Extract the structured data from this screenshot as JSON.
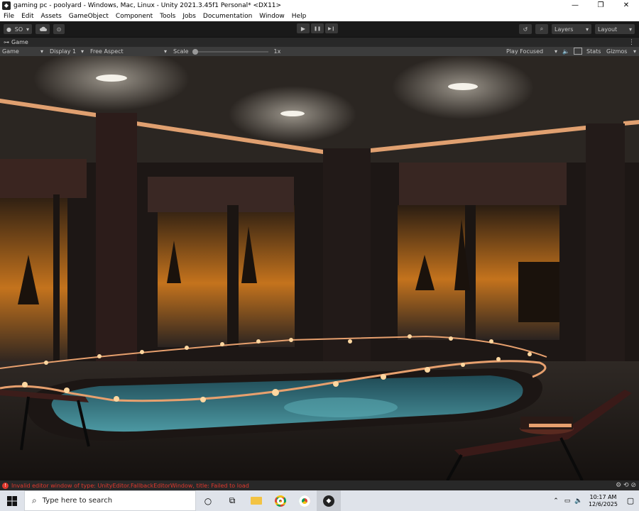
{
  "window": {
    "title": "gaming pc - poolyard - Windows, Mac, Linux - Unity 2021.3.45f1 Personal* <DX11>",
    "minimize": "—",
    "restore": "❐",
    "close": "✕"
  },
  "menu": [
    "File",
    "Edit",
    "Assets",
    "GameObject",
    "Component",
    "Tools",
    "Jobs",
    "Documentation",
    "Window",
    "Help"
  ],
  "toolbar": {
    "account_label": "SO",
    "play": "▶",
    "pause": "❚❚",
    "step": "▶❙",
    "layers_label": "Layers",
    "layout_label": "Layout"
  },
  "game_tab": {
    "tab_label": "Game",
    "view_label": "Game",
    "display_label": "Display 1",
    "aspect_label": "Free Aspect",
    "scale_label": "Scale",
    "scale_value": "1x",
    "play_mode_label": "Play Focused",
    "stats_label": "Stats",
    "gizmos_label": "Gizmos"
  },
  "status": {
    "message": "Invalid editor window of type: UnityEditor.FallbackEditorWindow, title: Failed to load"
  },
  "taskbar": {
    "search_placeholder": "Type here to search",
    "time": "10:17 AM",
    "date": "12/6/2025"
  },
  "colors": {
    "editor_dark": "#191919",
    "error_red": "#e0382d",
    "pool_water": "#2f6f7a",
    "neon_trim": "#e0a070"
  }
}
